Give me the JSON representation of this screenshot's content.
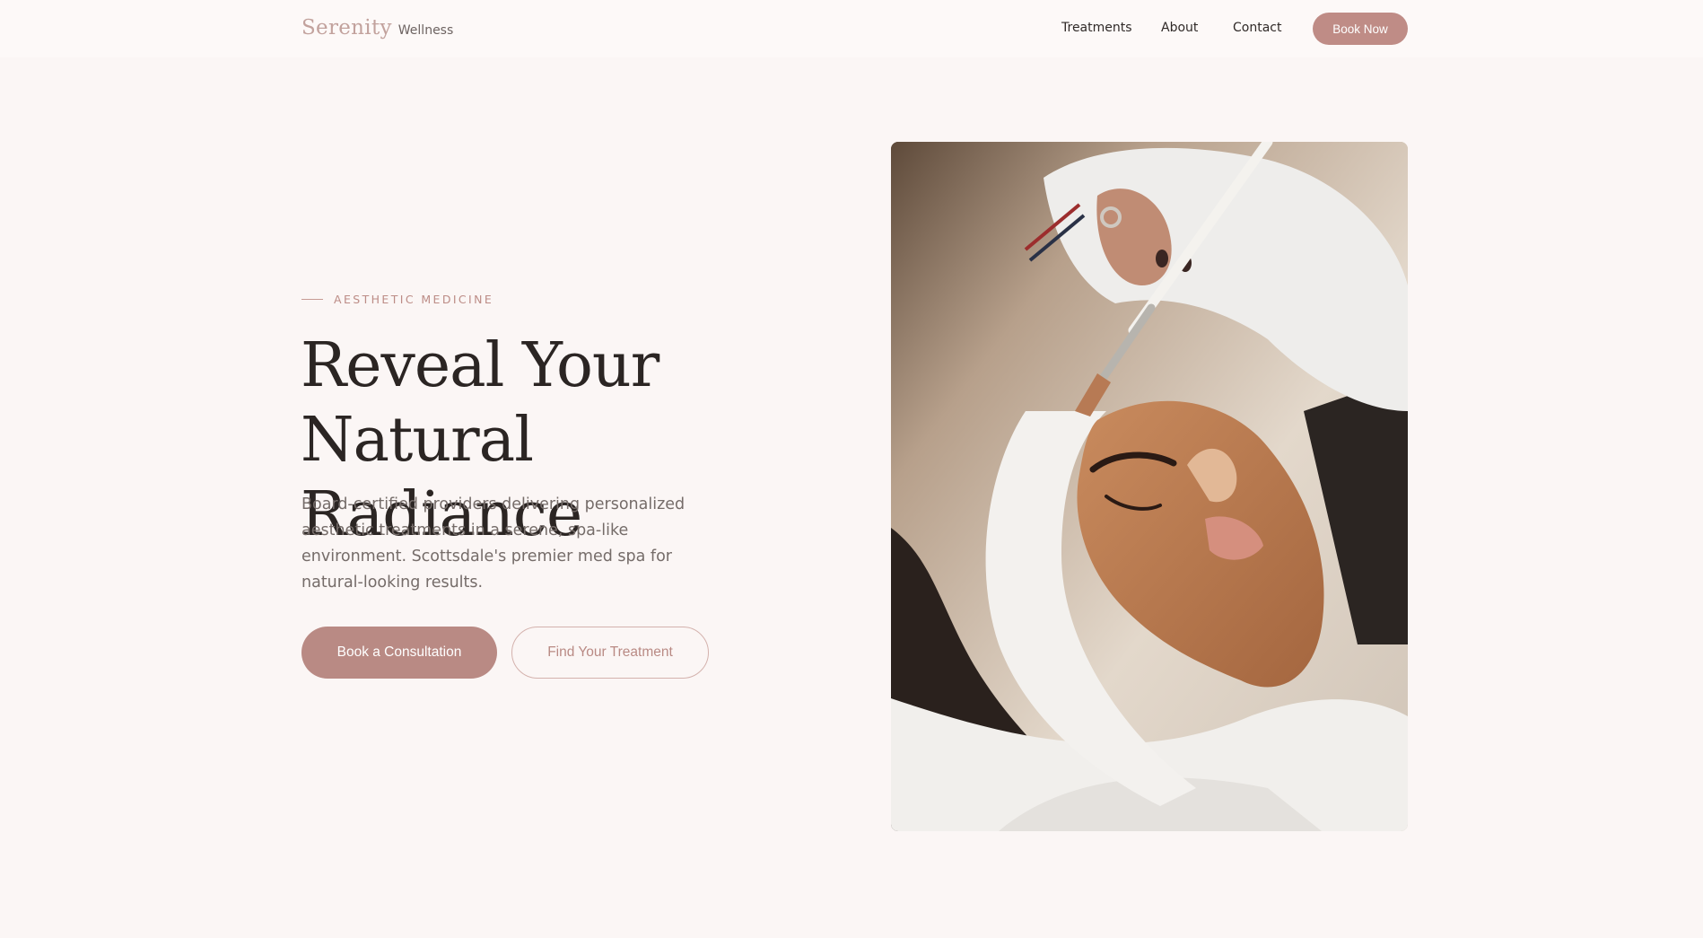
{
  "brand": {
    "name": "Serenity",
    "tagline": "Wellness"
  },
  "nav": {
    "links": [
      "Treatments",
      "About",
      "Contact"
    ],
    "cta_label": "Book Now"
  },
  "hero": {
    "eyebrow": "AESTHETIC MEDICINE",
    "headline_line1": "Reveal Your Natural",
    "headline_line2": "Radiance",
    "subtext": "Board-certified providers delivering personalized aesthetic treatments in a serene, spa-like environment. Scottsdale's premier med spa for natural-looking results.",
    "primary_cta": "Book a Consultation",
    "secondary_cta": "Find Your Treatment"
  },
  "colors": {
    "accent": "#bf8c86",
    "background": "#fbf6f5",
    "text": "#2b2523",
    "muted": "#756c69"
  }
}
